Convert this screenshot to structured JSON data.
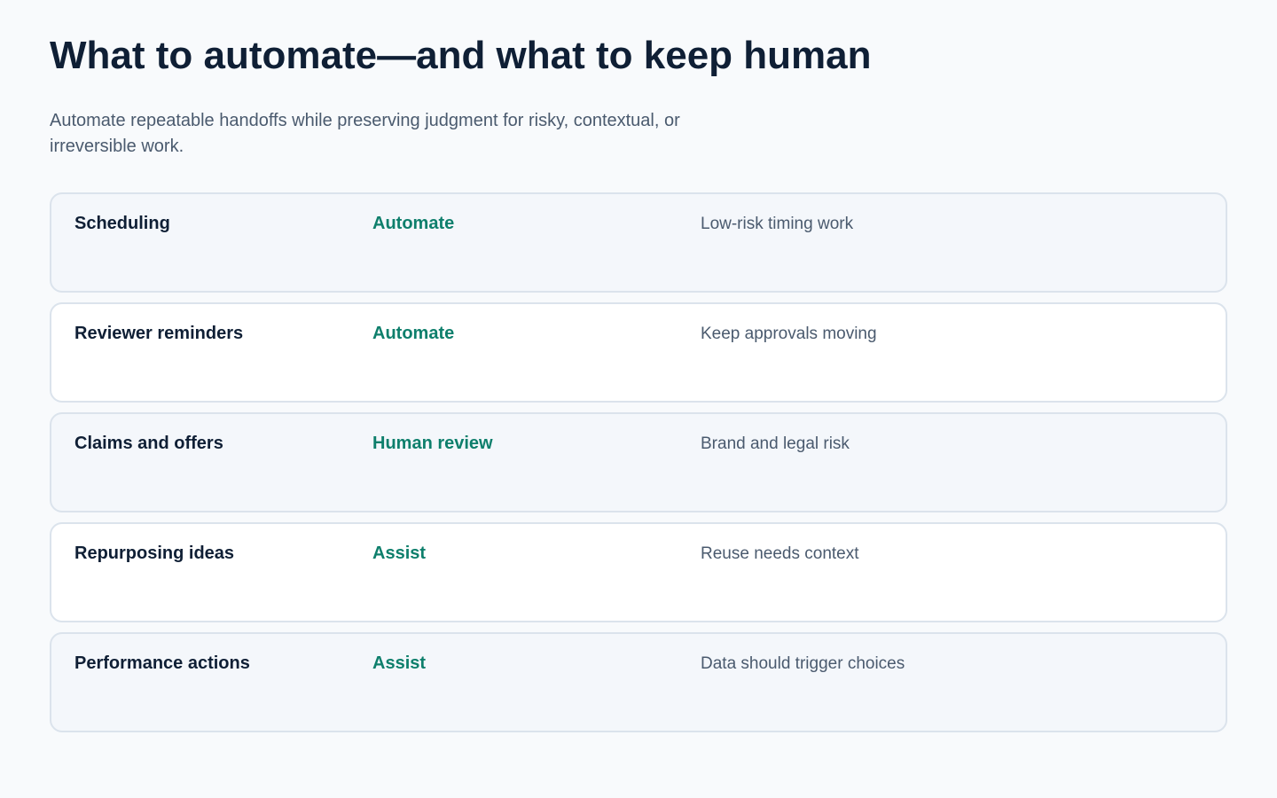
{
  "header": {
    "title": "What to automate—and what to keep human",
    "subtitle": "Automate repeatable handoffs while preserving judgment for risky, contextual, or irreversible work."
  },
  "rows": [
    {
      "item": "Scheduling",
      "action": "Automate",
      "reason": "Low-risk timing work"
    },
    {
      "item": "Reviewer reminders",
      "action": "Automate",
      "reason": "Keep approvals moving"
    },
    {
      "item": "Claims and offers",
      "action": "Human review",
      "reason": "Brand and legal risk"
    },
    {
      "item": "Repurposing ideas",
      "action": "Assist",
      "reason": "Reuse needs context"
    },
    {
      "item": "Performance actions",
      "action": "Assist",
      "reason": "Data should trigger choices"
    }
  ],
  "colors": {
    "background": "#f8fafc",
    "title": "#0f1f35",
    "action_accent": "#0e7f6c",
    "muted_text": "#4a5a6e",
    "row_border": "#dbe3ec"
  }
}
